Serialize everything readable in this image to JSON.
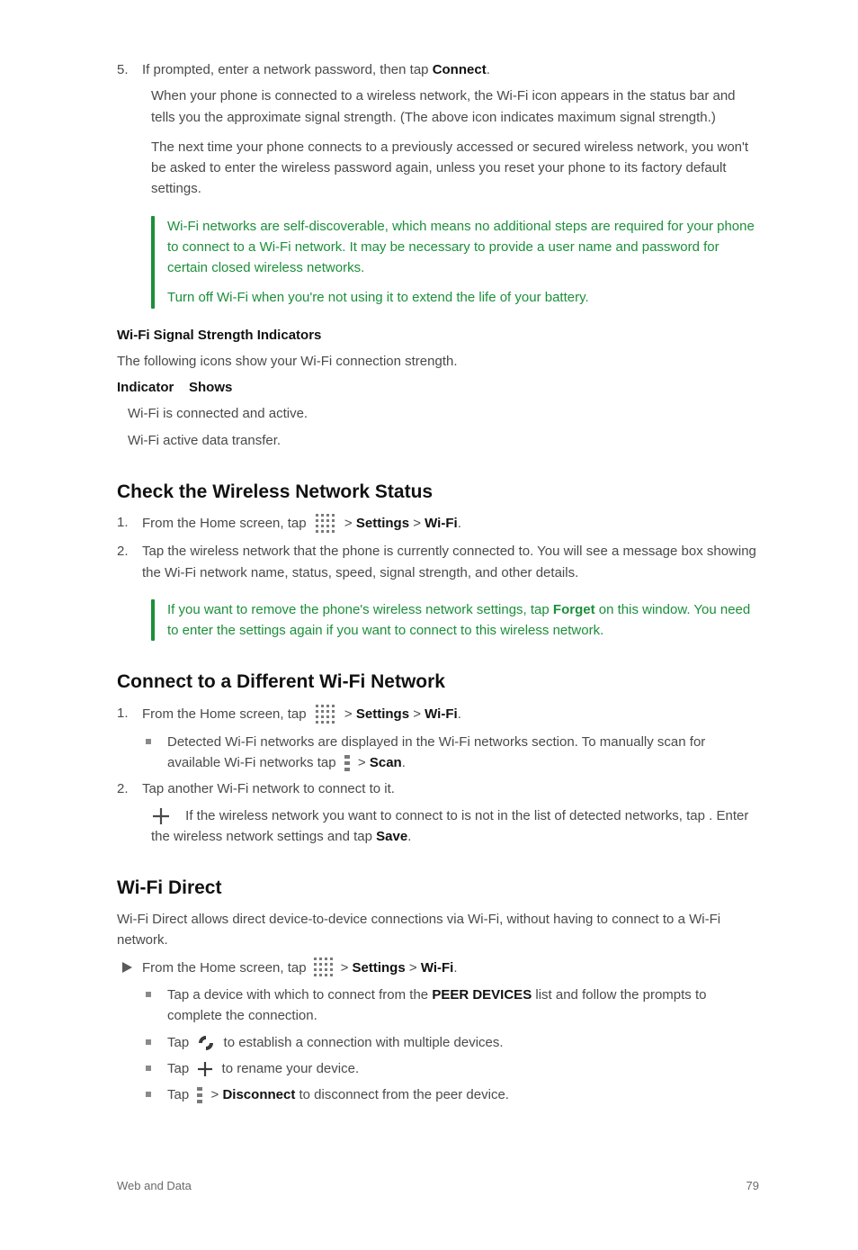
{
  "s1": {
    "step5_num": "5.",
    "step5": "If prompted, enter a network password, then tap ",
    "step5_connect": "Connect",
    "step5_after": ".",
    "connected": "When your phone is connected to a wireless network, the Wi-Fi icon appears in the status bar and tells you the approximate signal strength. (The above icon indicates maximum signal strength.)",
    "next_time": "The next time your phone connects to a previously accessed or secured wireless network, you won't be asked to enter the wireless password again, unless you reset your phone to its factory default settings.",
    "remember": [
      "Wi-Fi networks are self-discoverable, which means no additional steps are required for your phone to connect to a Wi-Fi network. It may be necessary to provide a user name and password for certain closed wireless networks.",
      "Turn off Wi-Fi when you're not using it to extend the life of your battery."
    ],
    "indicators": "Wi-Fi Signal Strength Indicators",
    "ind_intro": "The following icons show your Wi-Fi connection strength.",
    "ind_col1a": "Indicator",
    "ind_col1b": "Shows",
    "ind_wifi": "Wi-Fi is connected and active.",
    "ind_wifi_tx": "Wi-Fi active data transfer."
  },
  "s2": {
    "title": "Check the Wireless Network Status",
    "steps": {
      "n1": "1.",
      "t1a": "From the Home screen, tap ",
      "t1b": " > ",
      "t1c": "Settings",
      "t1d": " > ",
      "t1e": "Wi-Fi",
      "t1f": ".",
      "n2": "2.",
      "t2": "Tap the wireless network that the phone is currently connected to. You will see a message box showing the Wi-Fi network name, status, speed, signal strength, and other details.",
      "tip_a": "If you want to remove the phone's wireless network settings, tap ",
      "tip_b": "Forget",
      "tip_c": " on this window. You need to enter the settings again if you want to connect to this wireless network."
    }
  },
  "s3": {
    "title": "Connect to a Different Wi-Fi Network",
    "n1": "1.",
    "t1a": "From the Home screen, tap ",
    "t1b": " > ",
    "t1c": "Settings",
    "t1d": " > ",
    "t1e": "Wi-Fi",
    "t1f": ".",
    "b1": "Detected Wi-Fi networks are displayed in the Wi-Fi networks section. To manually scan for available Wi-Fi networks tap ",
    "b1_scan": " > ",
    "b1_scan2": "Scan",
    "b1_end": ".",
    "n2": "2.",
    "t2": "Tap another Wi-Fi network to connect to it.",
    "note_pre": "If the wireless network you want to connect to is not in the list of detected networks, tap ",
    "note_post": ". Enter the wireless network settings and tap ",
    "note_save": "Save",
    "note_end": "."
  },
  "s4": {
    "title": "Wi-Fi Direct",
    "intro": "Wi-Fi Direct allows direct device-to-device connections via Wi-Fi, without having to connect to a Wi-Fi network.",
    "head_pre": "From the Home screen, tap ",
    "head_mid": " > ",
    "head_set": "Settings",
    "head_mid2": " > ",
    "head_wf": "Wi-Fi",
    "head_end": ".",
    "b1": "Tap a device with which to connect from the ",
    "b1_peer": "PEER DEVICES",
    "b1_end": " list and follow the prompts to complete the connection.",
    "b2": "Tap ",
    "b2_end": " to establish a connection with multiple devices.",
    "b3": "Tap ",
    "b3_end": " to rename your device.",
    "b4a": "Tap ",
    "b4b": " > ",
    "b4c": "Disconnect",
    "b4d": " to disconnect from the peer device.",
    "footer_left": "Web and Data",
    "footer_right": "79"
  }
}
